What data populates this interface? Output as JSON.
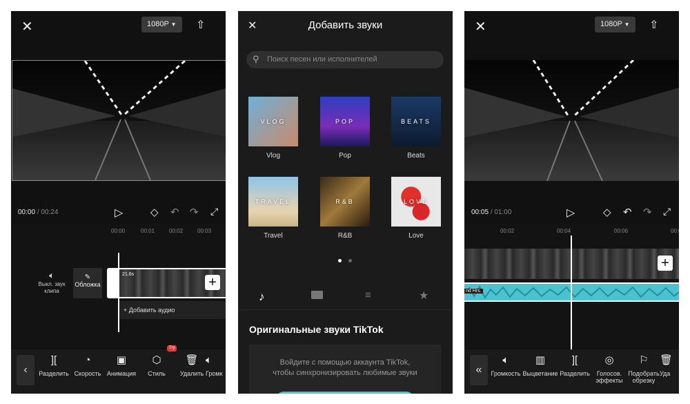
{
  "left": {
    "resolution": "1080P",
    "time_current": "00:00",
    "time_total": "00:24",
    "ruler": [
      "00:00",
      "00:01",
      "00:02",
      "00:03"
    ],
    "mute_label_line1": "Выкл. звук",
    "mute_label_line2": "клипа",
    "cover_label": "Обложка",
    "clip_duration": "21.6s",
    "add_audio": "+ Добавить аудио",
    "try_badge": "Try",
    "tools": [
      "Разделить",
      "Скорость",
      "Анимация",
      "Стиль",
      "Удалить",
      "Громк"
    ]
  },
  "middle": {
    "title": "Добавить звуки",
    "search_placeholder": "Поиск песен или исполнителей",
    "genres": [
      {
        "overlay": "VLOG",
        "label": "Vlog"
      },
      {
        "overlay": "POP",
        "label": "Pop"
      },
      {
        "overlay": "BEATS",
        "label": "Beats"
      },
      {
        "overlay": "TRAVEL",
        "label": "Travel"
      },
      {
        "overlay": "R&B",
        "label": "R&B"
      },
      {
        "overlay": "LOVE",
        "label": "Love"
      }
    ],
    "section_title": "Оригинальные звуки TikTok",
    "login_line1": "Войдите с помощью аккаунта TikTok,",
    "login_line2": "чтобы синхронизировать любимые звуки"
  },
  "right": {
    "resolution": "1080P",
    "time_current": "00:05",
    "time_total": "01:00",
    "ruler": [
      "00:02",
      "00:04",
      "00:06",
      "00:08"
    ],
    "audio_label": "nd Hrs.",
    "tools": [
      {
        "line1": "Громкость",
        "line2": ""
      },
      {
        "line1": "Выцветание",
        "line2": ""
      },
      {
        "line1": "Разделить",
        "line2": ""
      },
      {
        "line1": "Голосов.",
        "line2": "эффекты"
      },
      {
        "line1": "Подобрать",
        "line2": "обрезку"
      },
      {
        "line1": "Уда",
        "line2": ""
      }
    ]
  },
  "icons": {
    "close": "close-icon",
    "export": "upload-icon",
    "play": "play-icon",
    "undo": "undo-icon",
    "redo": "redo-icon",
    "fullscreen": "fullscreen-icon",
    "tiktok": "tiktok-icon",
    "folder": "folder-icon",
    "playlist": "playlist-icon",
    "star": "star-icon"
  },
  "colors": {
    "accent_teal": "#49c3d0",
    "background": "#111111",
    "badge_red": "#e03a3a"
  }
}
